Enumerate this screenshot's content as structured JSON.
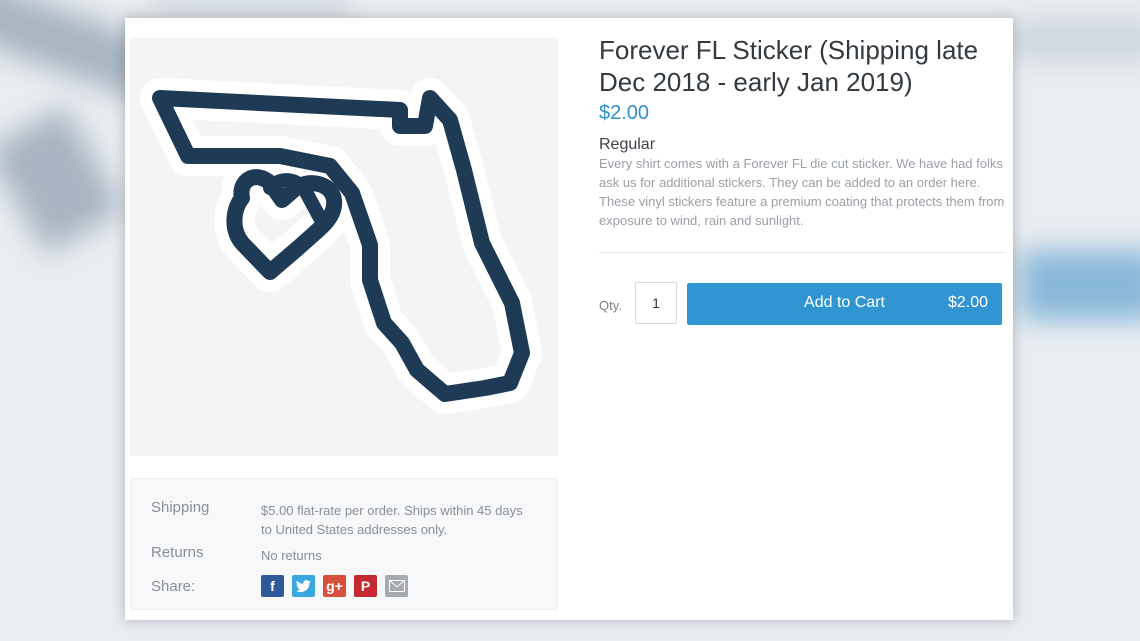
{
  "product": {
    "title": "Forever FL Sticker (Shipping late Dec 2018 - early Jan 2019)",
    "price": "$2.00",
    "variant": "Regular",
    "description": "Every shirt comes with a Forever FL die cut sticker. We have had folks ask us for additional stickers. They can be added to an order here. These vinyl stickers feature a premium coating that protects them from exposure to wind, rain and sunlight."
  },
  "purchase": {
    "qty_label": "Qty.",
    "qty_value": "1",
    "add_to_cart_label": "Add to Cart",
    "add_to_cart_price": "$2.00"
  },
  "details": {
    "shipping_label": "Shipping",
    "shipping_value": "$5.00 flat-rate per order. Ships within 45 days to United States addresses only.",
    "returns_label": "Returns",
    "returns_value": "No returns",
    "share_label": "Share:"
  },
  "share_icons": [
    "facebook-icon",
    "twitter-icon",
    "google-plus-icon",
    "pinterest-icon",
    "email-icon"
  ],
  "colors": {
    "accent": "#3195d1",
    "price": "#2e90cc",
    "sticker_navy": "#1f3a55"
  }
}
